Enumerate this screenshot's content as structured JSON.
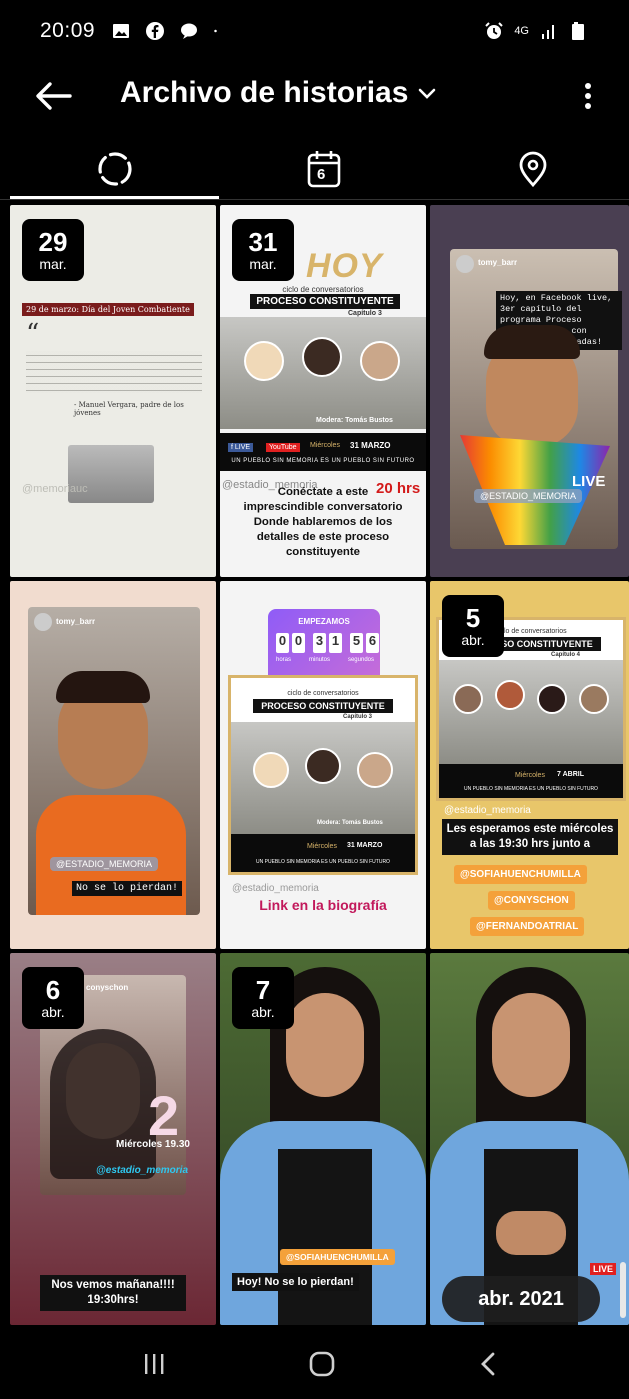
{
  "status_bar": {
    "time": "20:09",
    "network": "4G"
  },
  "header": {
    "title": "Archivo de historias"
  },
  "tabs": [
    {
      "name": "tab-stories",
      "icon": "dashed-circle-icon",
      "active": true
    },
    {
      "name": "tab-calendar",
      "icon": "calendar-icon",
      "calendar_number": "6"
    },
    {
      "name": "tab-map",
      "icon": "location-pin-icon"
    }
  ],
  "tiles": [
    {
      "date": {
        "day": "29",
        "month": "mar."
      },
      "handle": "@memoriauc",
      "heading": "29 de marzo: Día del Joven Combatiente",
      "quote_author": "- Manuel Vergara, padre de los jóvenes"
    },
    {
      "date": {
        "day": "31",
        "month": "mar."
      },
      "brand": "HOY",
      "subtitle": "ciclo de conversatorios",
      "banner": "PROCESO CONSTITUYENTE",
      "chapter": "Capítulo 3",
      "moderator": "Modera: Tomás Bustos",
      "event_day": "Miércoles",
      "event_date": "31 MARZO",
      "footer": "UN PUEBLO SIN MEMORIA ES UN PUEBLO SIN FUTURO",
      "handle": "@estadio_memoria",
      "tag": "20 hrs",
      "caption": "Conéctate a este imprescindible conversatorio Donde hablaremos de los detalles de este proceso constituyente"
    },
    {
      "user": "tomy_barr",
      "caption": "Hoy, en Facebook live, 3er capítulo del programa Proceso Constituyente con tremendas invitadas!",
      "sticker": "@ESTADIO_MEMORIA",
      "live": "LIVE"
    },
    {
      "user": "tomy_barr",
      "sticker": "@ESTADIO_MEMORIA",
      "caption": "No se lo pierdan!"
    },
    {
      "countdown_label": "EMPEZAMOS",
      "countdown_digits": [
        "0",
        "0",
        "3",
        "1",
        "5",
        "6"
      ],
      "countdown_units": [
        "horas",
        "minutos",
        "segundos"
      ],
      "subtitle": "ciclo de conversatorios",
      "banner": "PROCESO CONSTITUYENTE",
      "chapter": "Capítulo 3",
      "moderator": "Modera: Tomás Bustos",
      "event_day": "Miércoles",
      "event_date": "31 MARZO",
      "footer": "UN PUEBLO SIN MEMORIA ES UN PUEBLO SIN FUTURO",
      "handle": "@estadio_memoria",
      "caption": "Link en la biografía"
    },
    {
      "date": {
        "day": "5",
        "month": "abr."
      },
      "subtitle": "ciclo de conversatorios",
      "banner": "PROCESO CONSTITUYENTE",
      "chapter": "Capítulo 4",
      "event_day": "Miércoles",
      "event_date": "7 ABRIL",
      "footer": "UN PUEBLO SIN MEMORIA ES UN PUEBLO SIN FUTURO",
      "handle": "@estadio_memoria",
      "caption": "Les esperamos este miércoles a las 19:30 hrs junto a",
      "mentions": [
        "@SOFIAHUENCHUMILLA",
        "@CONYSCHON",
        "@FERNANDOATRIAL"
      ]
    },
    {
      "date": {
        "day": "6",
        "month": "abr."
      },
      "user": "conyschon",
      "number_sticker": "2",
      "event_line": "Miércoles 19.30",
      "handle": "@estadio_memoria",
      "caption": "Nos vemos mañana!!!! 19:30hrs!"
    },
    {
      "date": {
        "day": "7",
        "month": "abr."
      },
      "sticker": "@SOFIAHUENCHUMILLA",
      "caption": "Hoy! No se lo pierdan!"
    },
    {
      "live": "LIVE"
    }
  ],
  "month_pill": "abr. 2021",
  "nav": {
    "recents": "recents-icon",
    "home": "home-icon",
    "back": "back-icon"
  }
}
